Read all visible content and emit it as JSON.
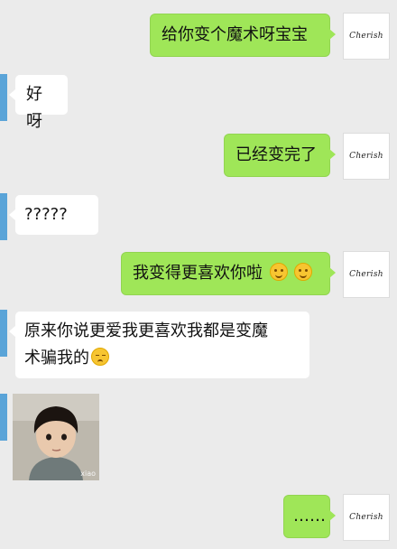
{
  "avatar_label": "Cherish",
  "messages": [
    {
      "side": "right",
      "text": "给你变个魔术呀宝宝"
    },
    {
      "side": "left",
      "text": "好呀"
    },
    {
      "side": "right",
      "text": "已经变完了"
    },
    {
      "side": "left",
      "text": "?????"
    },
    {
      "side": "right",
      "text": "我变得更喜欢你啦"
    },
    {
      "side": "left",
      "text_line1": "原来你说更爱我更喜欢我都是变魔",
      "text_line2": "术骗我的"
    },
    {
      "side": "left",
      "type": "image",
      "watermark": "xiao"
    },
    {
      "side": "right",
      "text": "……"
    }
  ],
  "emoji": {
    "smile": "smiling-face",
    "pensive": "pensive-face"
  },
  "colors": {
    "me_bubble": "#9fe658",
    "other_bubble": "#ffffff",
    "background": "#ebebeb",
    "left_avatar_strip": "#5aa4d8"
  }
}
